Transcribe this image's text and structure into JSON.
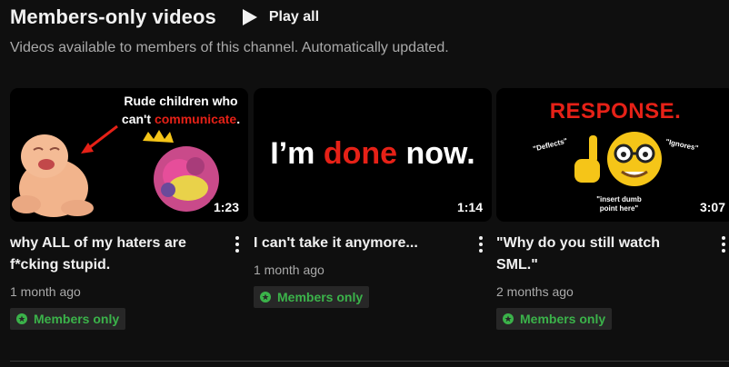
{
  "shelf": {
    "title": "Members-only videos",
    "play_all_label": "Play all",
    "subtitle": "Videos available to members of this channel. Automatically updated."
  },
  "videos": [
    {
      "title": "why ALL of my haters are f*cking stupid.",
      "duration": "1:23",
      "age": "1 month ago",
      "badge": "Members only",
      "thumb_text_line1": "Rude children who",
      "thumb_text_line2_prefix": "can't ",
      "thumb_text_line2_highlight": "communicate",
      "thumb_text_line2_suffix": "."
    },
    {
      "title": "I can't take it anymore...",
      "duration": "1:14",
      "age": "1 month ago",
      "badge": "Members only",
      "thumb_text_prefix": "I’m ",
      "thumb_text_highlight": "done",
      "thumb_text_suffix": " now."
    },
    {
      "title": "\"Why do you still watch SML.\"",
      "duration": "3:07",
      "age": "2 months ago",
      "badge": "Members only",
      "thumb_heading": "RESPONSE.",
      "thumb_left_label": "\"Deflects\"",
      "thumb_right_label": "\"Ignores\"",
      "thumb_bottom_line1": "\"insert dumb",
      "thumb_bottom_line2": "point here\""
    }
  ],
  "colors": {
    "background": "#0f0f0f",
    "text_primary": "#f1f1f1",
    "text_secondary": "#aaaaaa",
    "members_green": "#3bb34a",
    "thumb_red": "#e62117"
  }
}
